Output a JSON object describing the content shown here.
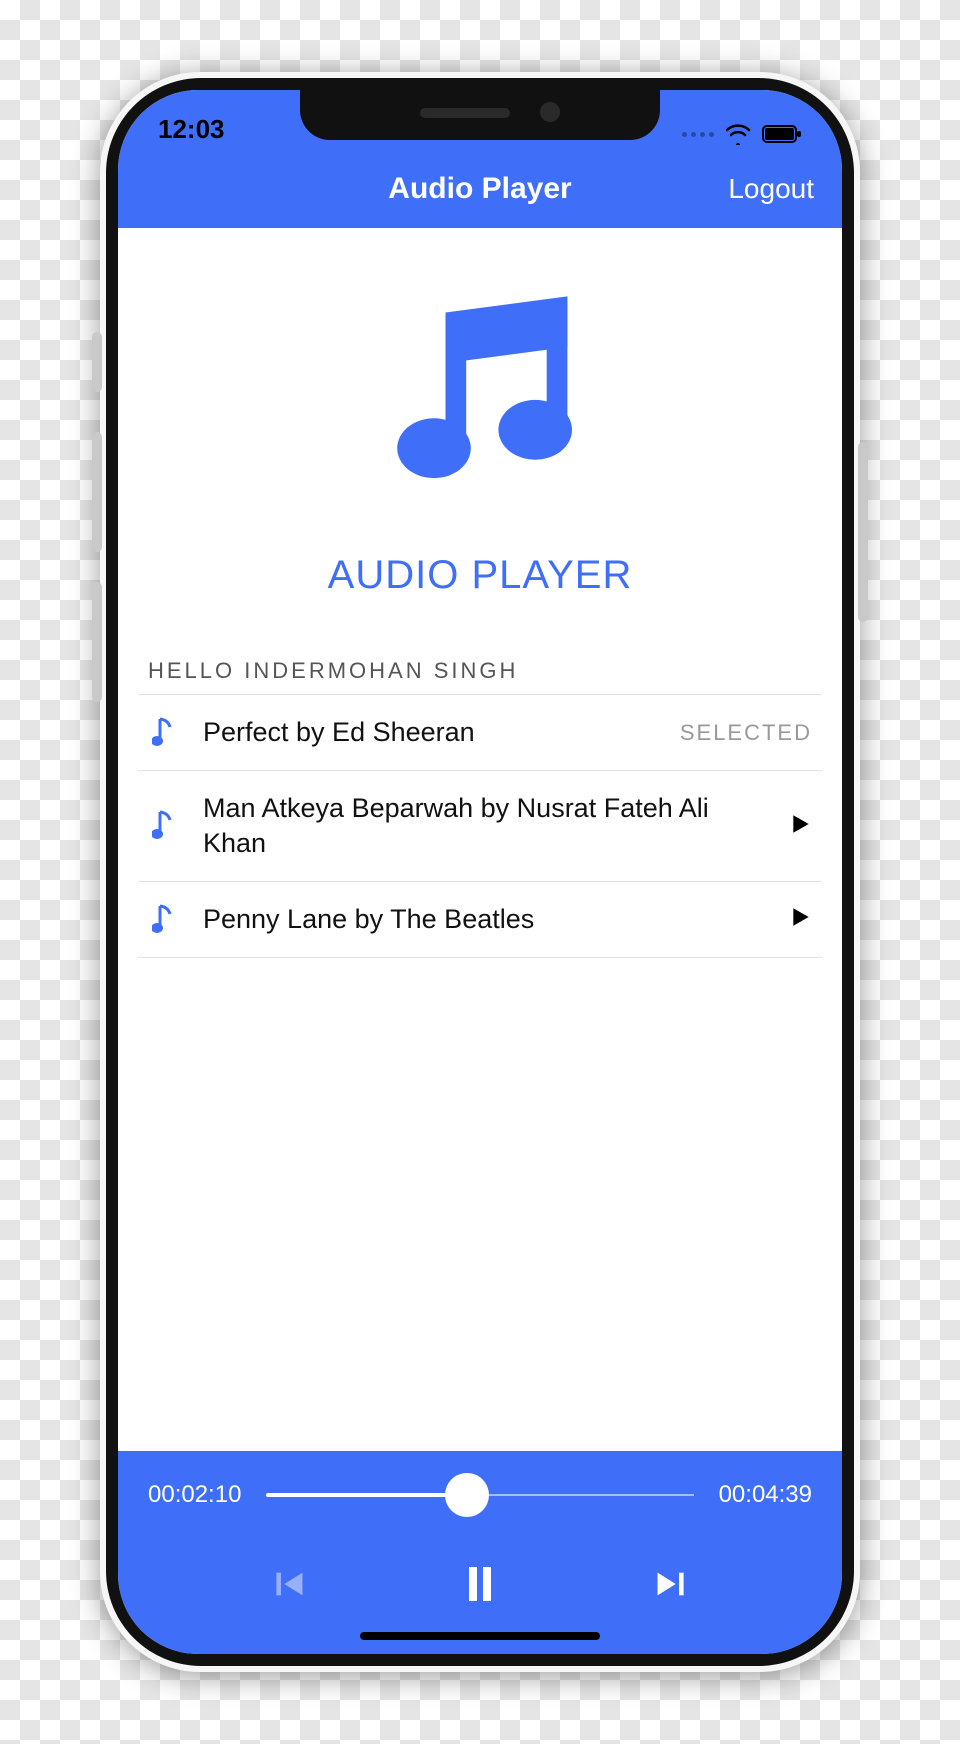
{
  "status": {
    "time": "12:03"
  },
  "nav": {
    "title": "Audio Player",
    "logout": "Logout"
  },
  "hero": {
    "title": "AUDIO PLAYER"
  },
  "greeting": "Hello Indermohan Singh",
  "tracks": [
    {
      "title": "Perfect by Ed Sheeran",
      "status": "SELECTED",
      "selected": true
    },
    {
      "title": "Man Atkeya Beparwah by Nusrat Fateh Ali Khan",
      "status": "",
      "selected": false
    },
    {
      "title": "Penny Lane by The Beatles",
      "status": "",
      "selected": false
    }
  ],
  "player": {
    "elapsed": "00:02:10",
    "duration": "00:04:39",
    "progress_percent": 47
  },
  "colors": {
    "accent": "#3f6ff8"
  }
}
